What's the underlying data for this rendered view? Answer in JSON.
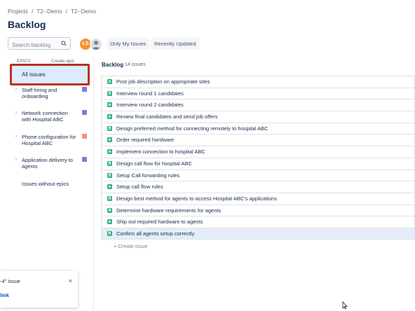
{
  "breadcrumb": [
    "Projects",
    "/",
    "T2--Demo",
    "/",
    "T2--Demo"
  ],
  "page_title": "Backlog",
  "search": {
    "placeholder": "Search backlog"
  },
  "avatars": {
    "ls_initials": "LS"
  },
  "filters": {
    "only_my_issues": "Only My Issues",
    "recently_updated": "Recently Updated"
  },
  "sidebar": {
    "epics_label": "EPICS",
    "create_epic": "Create epic",
    "all_issues": "All issues",
    "epics": [
      {
        "label": "Staff hiring and onboarding",
        "color": "#8777d9"
      },
      {
        "label": "Network connection with Hospital ABC",
        "color": "#8777d9"
      },
      {
        "label": "Phone configuration for Hospital ABC",
        "color": "#ff8f73"
      },
      {
        "label": "Application delivery to agents",
        "color": "#8777d9"
      }
    ],
    "issues_without_epics": "Issues without epics"
  },
  "backlog": {
    "title": "Backlog",
    "count": "14 issues",
    "issues": [
      "Post job description on appropriate sites",
      "Interview round 1 candidates",
      "Interview round 2 candidates",
      "Review final candidates and send job offers",
      "Design preferred method for connecting remotely to hospital ABC",
      "Order required hardware",
      "Implement connection to hospital ABC",
      "Design call flow for hospital ABC",
      "Setup Call forwarding rules",
      "Setup call flow rules",
      "Design best method for agents to access Hospital ABC's applications",
      "Determine hardware requirements for agents",
      "Ship out required hardware to agents",
      "Confirm all agents setup correctly"
    ],
    "create_issue": "+ Create issue"
  },
  "toast": {
    "text": "-4\" issue",
    "link": "link",
    "close": "×"
  },
  "colors": {
    "highlight_border": "#b5331c",
    "story_green": "#36b37e",
    "selected_bg": "#deebff"
  }
}
